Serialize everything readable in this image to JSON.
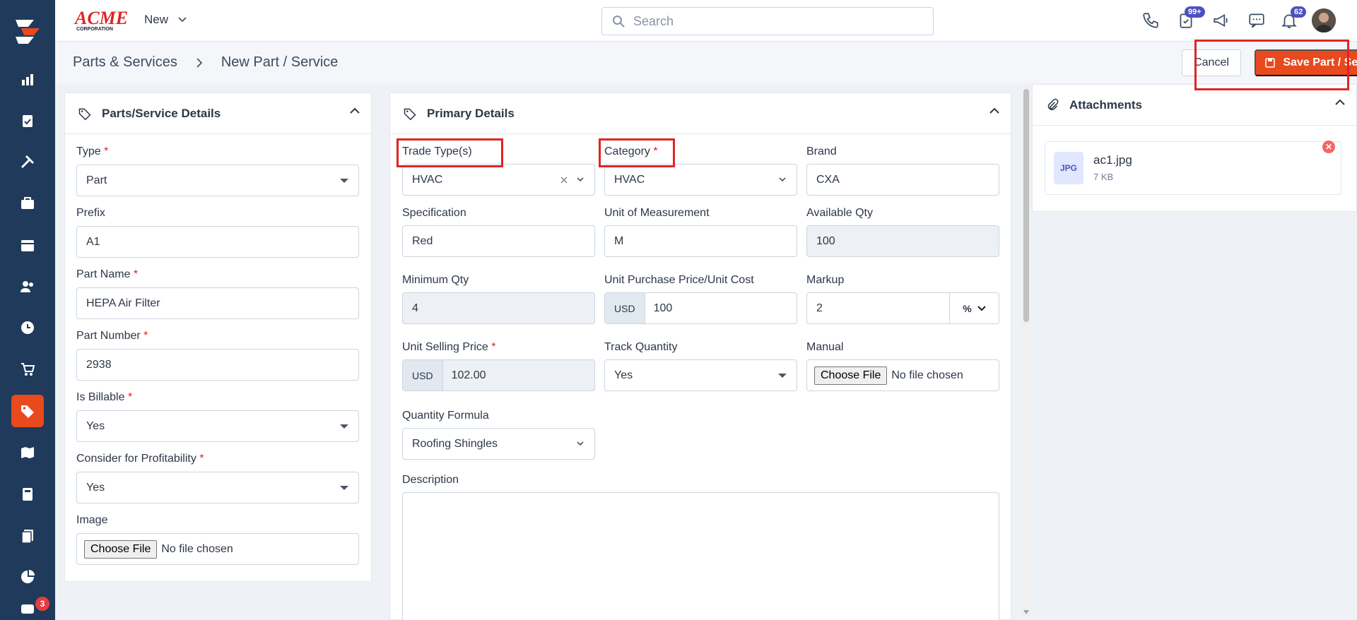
{
  "app": {
    "brand": "ACME",
    "brand_sub": "CORPORATION",
    "new_menu_label": "New"
  },
  "search": {
    "placeholder": "Search"
  },
  "notifications": {
    "tasks_badge": "99+",
    "bell_badge": "62",
    "chat_badge": "3"
  },
  "breadcrumb": {
    "parent": "Parts & Services",
    "current": "New Part / Service"
  },
  "actions": {
    "cancel": "Cancel",
    "save": "Save Part / Service"
  },
  "left_panel": {
    "title": "Parts/Service Details",
    "type": {
      "label": "Type",
      "value": "Part"
    },
    "prefix": {
      "label": "Prefix",
      "value": "A1"
    },
    "part_name": {
      "label": "Part Name",
      "value": "HEPA Air Filter"
    },
    "part_number": {
      "label": "Part Number",
      "value": "2938"
    },
    "is_billable": {
      "label": "Is Billable",
      "value": "Yes"
    },
    "profitability": {
      "label": "Consider for Profitability",
      "value": "Yes"
    },
    "image": {
      "label": "Image",
      "button": "Choose File",
      "status": "No file chosen"
    }
  },
  "primary": {
    "title": "Primary Details",
    "trade_type": {
      "label": "Trade Type(s)",
      "value": "HVAC"
    },
    "category": {
      "label": "Category",
      "value": "HVAC"
    },
    "brand": {
      "label": "Brand",
      "value": "CXA"
    },
    "specification": {
      "label": "Specification",
      "value": "Red"
    },
    "uom": {
      "label": "Unit of Measurement",
      "value": "M"
    },
    "available_qty": {
      "label": "Available Qty",
      "value": "100"
    },
    "min_qty": {
      "label": "Minimum Qty",
      "value": "4"
    },
    "unit_cost": {
      "label": "Unit Purchase Price/Unit Cost",
      "currency": "USD",
      "value": "100"
    },
    "markup": {
      "label": "Markup",
      "value": "2",
      "unit": "%"
    },
    "selling_price": {
      "label": "Unit Selling Price",
      "currency": "USD",
      "value": "102.00"
    },
    "track_qty": {
      "label": "Track Quantity",
      "value": "Yes"
    },
    "manual": {
      "label": "Manual",
      "button": "Choose File",
      "status": "No file chosen"
    },
    "qty_formula": {
      "label": "Quantity Formula",
      "value": "Roofing Shingles"
    },
    "description": {
      "label": "Description",
      "value": ""
    }
  },
  "attachments": {
    "title": "Attachments",
    "files": [
      {
        "type": "JPG",
        "name": "ac1.jpg",
        "size": "7 KB"
      }
    ]
  },
  "colors": {
    "sidebar": "#1f3a5a",
    "accent": "#e8491d",
    "highlight": "#e02424"
  }
}
